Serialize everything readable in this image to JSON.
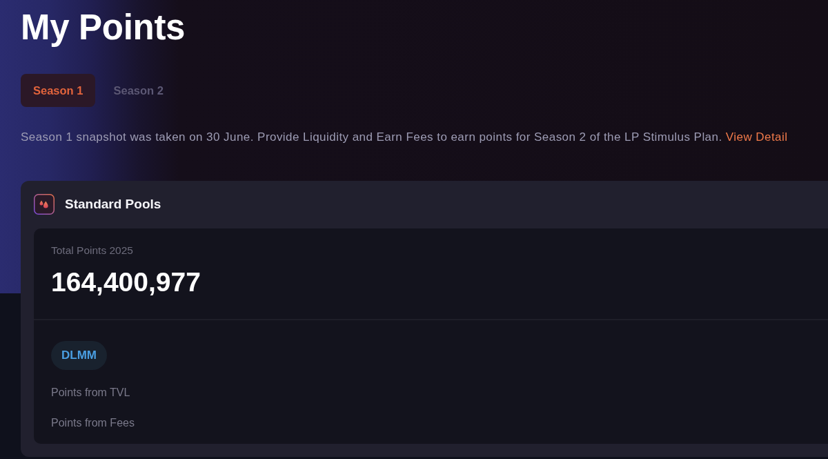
{
  "page": {
    "title": "My Points"
  },
  "tabs": [
    {
      "label": "Season 1",
      "selected": true
    },
    {
      "label": "Season 2",
      "selected": false
    }
  ],
  "notice": {
    "text": "Season 1 snapshot was taken on 30 June. Provide Liquidity and Earn Fees to earn points for Season 2 of the LP Stimulus Plan.",
    "link": "View Detail"
  },
  "card": {
    "title": "Standard Pools",
    "total": {
      "label": "Total Points 2025",
      "value": "164,400,977"
    },
    "pool_tag": "DLMM",
    "breakdown": [
      "Points from TVL",
      "Points from Fees"
    ]
  }
}
